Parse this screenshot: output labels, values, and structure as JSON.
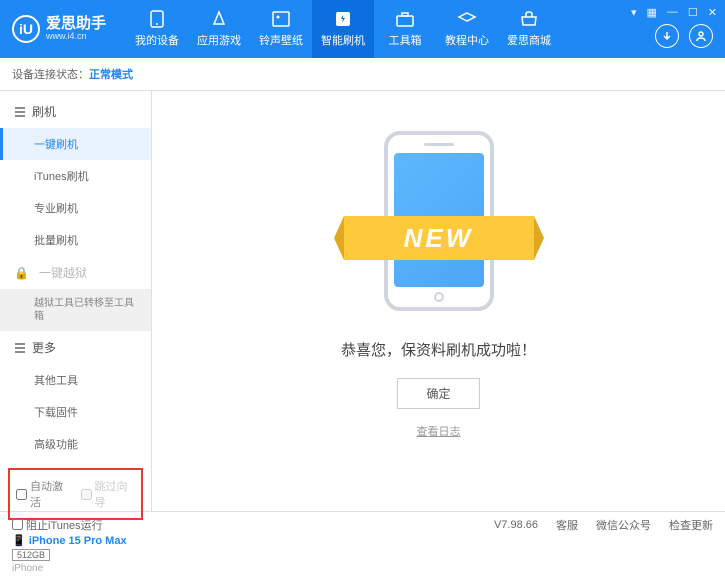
{
  "header": {
    "logo_letter": "iU",
    "title": "爱思助手",
    "url": "www.i4.cn",
    "nav": [
      {
        "label": "我的设备"
      },
      {
        "label": "应用游戏"
      },
      {
        "label": "铃声壁纸"
      },
      {
        "label": "智能刷机"
      },
      {
        "label": "工具箱"
      },
      {
        "label": "教程中心"
      },
      {
        "label": "爱思商城"
      }
    ]
  },
  "status": {
    "label": "设备连接状态：",
    "value": "正常模式"
  },
  "sidebar": {
    "section_flash": "刷机",
    "items_flash": [
      "一键刷机",
      "iTunes刷机",
      "专业刷机",
      "批量刷机"
    ],
    "section_jailbreak": "一键越狱",
    "jailbreak_note": "越狱工具已转移至工具箱",
    "section_more": "更多",
    "items_more": [
      "其他工具",
      "下载固件",
      "高级功能"
    ],
    "checkbox1": "自动激活",
    "checkbox2": "跳过向导",
    "device_name": "iPhone 15 Pro Max",
    "device_storage": "512GB",
    "device_type": "iPhone"
  },
  "main": {
    "new_text": "NEW",
    "success": "恭喜您，保资料刷机成功啦！",
    "ok": "确定",
    "log": "查看日志"
  },
  "footer": {
    "block_itunes": "阻止iTunes运行",
    "version": "V7.98.66",
    "links": [
      "客服",
      "微信公众号",
      "检查更新"
    ]
  }
}
